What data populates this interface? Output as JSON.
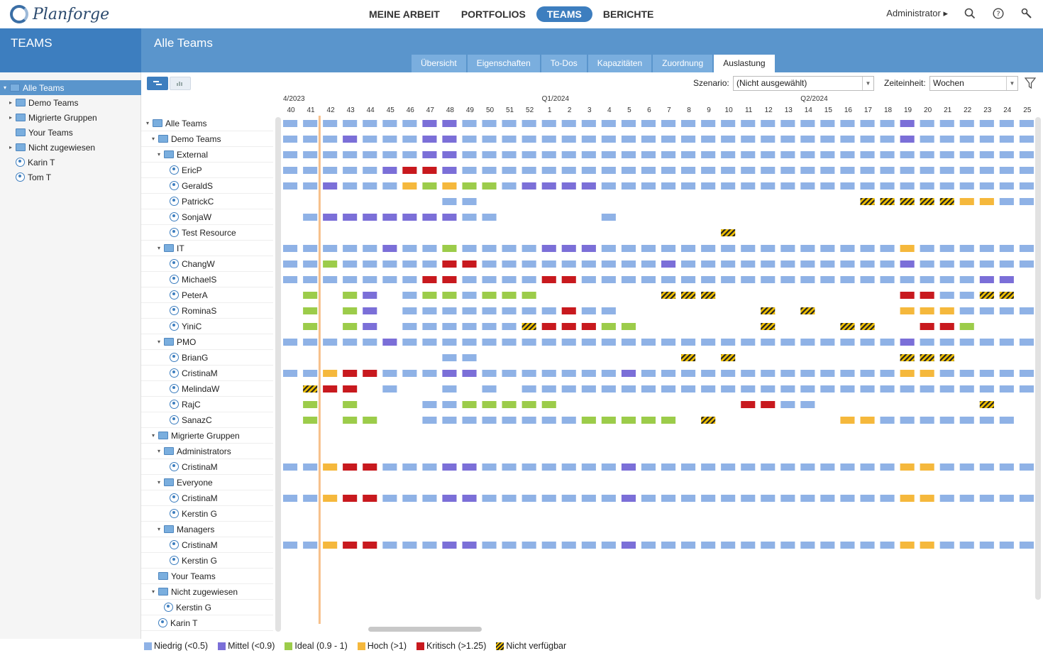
{
  "app": {
    "logo_text": "Planforge"
  },
  "nav": [
    {
      "label": "MEINE ARBEIT",
      "active": false
    },
    {
      "label": "PORTFOLIOS",
      "active": false
    },
    {
      "label": "TEAMS",
      "active": true
    },
    {
      "label": "BERICHTE",
      "active": false
    }
  ],
  "top_right": {
    "user": "Administrator ▸",
    "icons": [
      "search-icon",
      "help-icon",
      "tools-icon"
    ]
  },
  "left_panel": {
    "title": "TEAMS",
    "tree": [
      {
        "label": "Alle Teams",
        "type": "folder",
        "expander": "▾",
        "selected": true
      },
      {
        "label": "Demo Teams",
        "type": "folder",
        "expander": "▸",
        "indent": 1
      },
      {
        "label": "Migrierte Gruppen",
        "type": "folder",
        "expander": "▸",
        "indent": 1
      },
      {
        "label": "Your Teams",
        "type": "folder",
        "expander": "",
        "indent": 1
      },
      {
        "label": "Nicht zugewiesen",
        "type": "folder",
        "expander": "▸",
        "indent": 1
      },
      {
        "label": "Karin T",
        "type": "person",
        "expander": "",
        "indent": 1
      },
      {
        "label": "Tom T",
        "type": "person",
        "expander": "",
        "indent": 1
      }
    ]
  },
  "main": {
    "title": "Alle Teams",
    "tabs": [
      {
        "label": "Übersicht",
        "active": false
      },
      {
        "label": "Eigenschaften",
        "active": false
      },
      {
        "label": "To-Dos",
        "active": false
      },
      {
        "label": "Kapazitäten",
        "active": false
      },
      {
        "label": "Zuordnung",
        "active": false
      },
      {
        "label": "Auslastung",
        "active": true
      }
    ],
    "toolbar": {
      "scenario_label": "Szenario:",
      "scenario_value": "(Nicht ausgewählt)",
      "unit_label": "Zeiteinheit:",
      "unit_value": "Wochen"
    }
  },
  "gantt": {
    "quarters": [
      {
        "label": "4/2023",
        "week_index": 0
      },
      {
        "label": "Q1/2024",
        "week_index": 13
      },
      {
        "label": "Q2/2024",
        "week_index": 26
      }
    ],
    "weeks": [
      "40",
      "41",
      "42",
      "43",
      "44",
      "45",
      "46",
      "47",
      "48",
      "49",
      "50",
      "51",
      "52",
      "1",
      "2",
      "3",
      "4",
      "5",
      "6",
      "7",
      "8",
      "9",
      "10",
      "11",
      "12",
      "13",
      "14",
      "15",
      "16",
      "17",
      "18",
      "19",
      "20",
      "21",
      "22",
      "23",
      "24",
      "25"
    ],
    "today_week_index": 1.6,
    "rows": [
      {
        "label": "Alle Teams",
        "type": "folder",
        "indent": 0,
        "expander": "▾",
        "pattern": "all"
      },
      {
        "label": "Demo Teams",
        "type": "folder",
        "indent": 1,
        "expander": "▾",
        "pattern": "demo"
      },
      {
        "label": "External",
        "type": "folder",
        "indent": 2,
        "expander": "▾",
        "pattern": "ext"
      },
      {
        "label": "EricP",
        "type": "person",
        "indent": 3,
        "expander": "",
        "pattern": "eric"
      },
      {
        "label": "GeraldS",
        "type": "person",
        "indent": 3,
        "expander": "",
        "pattern": "gerald"
      },
      {
        "label": "PatrickC",
        "type": "person",
        "indent": 3,
        "expander": "",
        "pattern": "patrick"
      },
      {
        "label": "SonjaW",
        "type": "person",
        "indent": 3,
        "expander": "",
        "pattern": "sonja"
      },
      {
        "label": "Test Resource",
        "type": "person",
        "indent": 3,
        "expander": "",
        "pattern": "test"
      },
      {
        "label": "IT",
        "type": "folder",
        "indent": 2,
        "expander": "▾",
        "pattern": "it"
      },
      {
        "label": "ChangW",
        "type": "person",
        "indent": 3,
        "expander": "",
        "pattern": "chang"
      },
      {
        "label": "MichaelS",
        "type": "person",
        "indent": 3,
        "expander": "",
        "pattern": "michael"
      },
      {
        "label": "PeterA",
        "type": "person",
        "indent": 3,
        "expander": "",
        "pattern": "peter"
      },
      {
        "label": "RominaS",
        "type": "person",
        "indent": 3,
        "expander": "",
        "pattern": "romina"
      },
      {
        "label": "YiniC",
        "type": "person",
        "indent": 3,
        "expander": "",
        "pattern": "yini"
      },
      {
        "label": "PMO",
        "type": "folder",
        "indent": 2,
        "expander": "▾",
        "pattern": "pmo"
      },
      {
        "label": "BrianG",
        "type": "person",
        "indent": 3,
        "expander": "",
        "pattern": "brian"
      },
      {
        "label": "CristinaM",
        "type": "person",
        "indent": 3,
        "expander": "",
        "pattern": "cristina"
      },
      {
        "label": "MelindaW",
        "type": "person",
        "indent": 3,
        "expander": "",
        "pattern": "melinda"
      },
      {
        "label": "RajC",
        "type": "person",
        "indent": 3,
        "expander": "",
        "pattern": "raj"
      },
      {
        "label": "SanazC",
        "type": "person",
        "indent": 3,
        "expander": "",
        "pattern": "sanaz"
      },
      {
        "label": "Migrierte Gruppen",
        "type": "folder",
        "indent": 1,
        "expander": "▾",
        "pattern": "empty"
      },
      {
        "label": "Administrators",
        "type": "folder",
        "indent": 2,
        "expander": "▾",
        "pattern": "empty"
      },
      {
        "label": "CristinaM",
        "type": "person",
        "indent": 3,
        "expander": "",
        "pattern": "cristina2"
      },
      {
        "label": "Everyone",
        "type": "folder",
        "indent": 2,
        "expander": "▾",
        "pattern": "empty"
      },
      {
        "label": "CristinaM",
        "type": "person",
        "indent": 3,
        "expander": "",
        "pattern": "cristina2"
      },
      {
        "label": "Kerstin G",
        "type": "person",
        "indent": 3,
        "expander": "",
        "pattern": "empty"
      },
      {
        "label": "Managers",
        "type": "folder",
        "indent": 2,
        "expander": "▾",
        "pattern": "empty"
      },
      {
        "label": "CristinaM",
        "type": "person",
        "indent": 3,
        "expander": "",
        "pattern": "cristina2"
      },
      {
        "label": "Kerstin G",
        "type": "person",
        "indent": 3,
        "expander": "",
        "pattern": "empty"
      },
      {
        "label": "Your Teams",
        "type": "folder",
        "indent": 1,
        "expander": "",
        "pattern": "empty"
      },
      {
        "label": "Nicht zugewiesen",
        "type": "folder",
        "indent": 1,
        "expander": "▾",
        "pattern": "empty"
      },
      {
        "label": "Kerstin G",
        "type": "person",
        "indent": 2,
        "expander": "",
        "pattern": "empty"
      },
      {
        "label": "Karin T",
        "type": "person",
        "indent": 1,
        "expander": "",
        "pattern": "empty"
      }
    ]
  },
  "legend": [
    {
      "label": "Niedrig (<0.5)",
      "color": "#8fb2e6"
    },
    {
      "label": "Mittel (<0.9)",
      "color": "#7b6fd8"
    },
    {
      "label": "Ideal (0.9 - 1)",
      "color": "#9ccc4a"
    },
    {
      "label": "Hoch (>1)",
      "color": "#f5b83c"
    },
    {
      "label": "Kritisch (>1.25)",
      "color": "#c8191e"
    },
    {
      "label": "Nicht verfügbar",
      "color": "hatch"
    }
  ],
  "colors": {
    "accent": "#3d7ebf",
    "low": "#8fb2e6",
    "mid": "#7b6fd8",
    "ideal": "#9ccc4a",
    "high": "#f5b83c",
    "critical": "#c8191e"
  }
}
